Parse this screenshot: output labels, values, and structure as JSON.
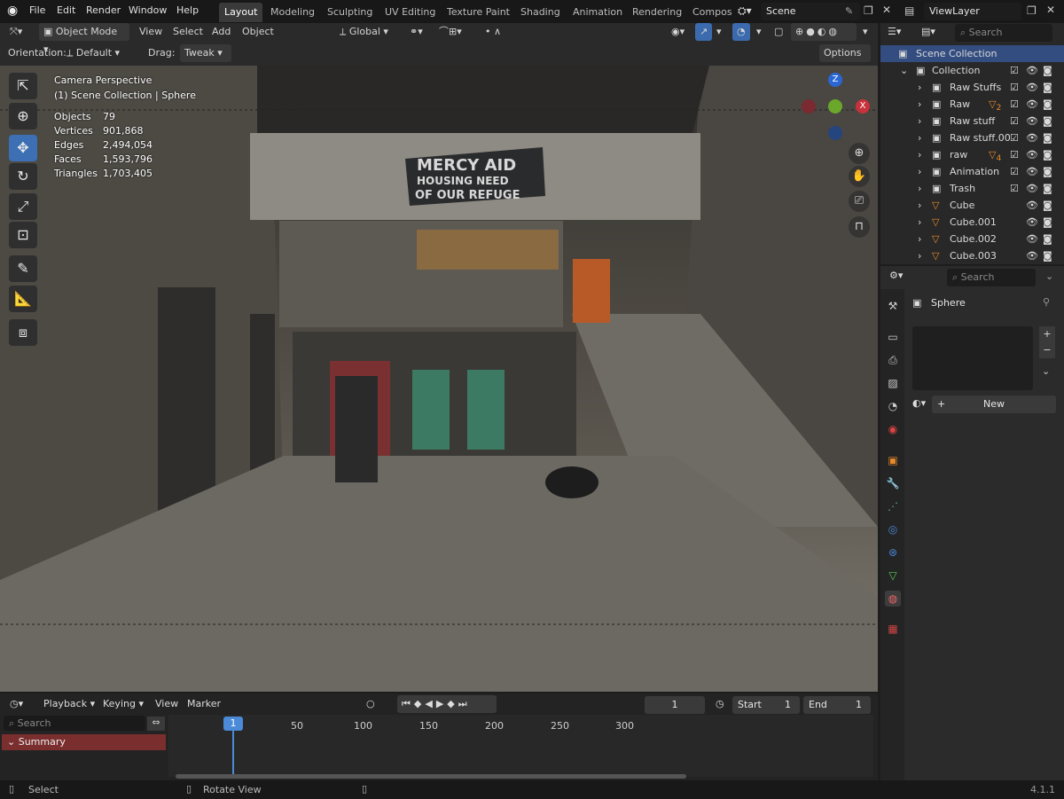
{
  "menu": {
    "file": "File",
    "edit": "Edit",
    "render": "Render",
    "window": "Window",
    "help": "Help"
  },
  "workspaces": [
    "Layout",
    "Modeling",
    "Sculpting",
    "UV Editing",
    "Texture Paint",
    "Shading",
    "Animation",
    "Rendering",
    "Compos"
  ],
  "scene": "Scene",
  "view_layer": "ViewLayer",
  "vp_header": {
    "mode": "Object Mode",
    "view": "View",
    "select": "Select",
    "add": "Add",
    "object": "Object",
    "transform": "Global",
    "orientation_label": "Orientation:",
    "orientation": "Default",
    "drag_label": "Drag:",
    "drag": "Tweak",
    "options": "Options"
  },
  "overlay": {
    "camera": "Camera Perspective",
    "collection": "(1) Scene Collection | Sphere",
    "stats": [
      {
        "k": "Objects",
        "v": "79"
      },
      {
        "k": "Vertices",
        "v": "901,868"
      },
      {
        "k": "Edges",
        "v": "2,494,054"
      },
      {
        "k": "Faces",
        "v": "1,593,796"
      },
      {
        "k": "Triangles",
        "v": "1,703,405"
      }
    ]
  },
  "scene_art": {
    "sign1": "MERCY AID",
    "sign2": "HOUSING   NEED",
    "sign3": "OF OUR REFUGE"
  },
  "outliner": {
    "search": "Search",
    "root": "Scene Collection",
    "collection": "Collection",
    "items": [
      {
        "name": "Raw Stuffs",
        "badge": ""
      },
      {
        "name": "Raw",
        "badge": "2"
      },
      {
        "name": "Raw stuff",
        "badge": ""
      },
      {
        "name": "Raw stuff.00",
        "badge": ""
      },
      {
        "name": "raw",
        "badge": "4"
      },
      {
        "name": "Animation",
        "badge": ""
      },
      {
        "name": "Trash",
        "badge": ""
      },
      {
        "name": "Cube",
        "badge": ""
      },
      {
        "name": "Cube.001",
        "badge": ""
      },
      {
        "name": "Cube.002",
        "badge": ""
      },
      {
        "name": "Cube.003",
        "badge": ""
      }
    ]
  },
  "properties": {
    "search": "Search",
    "object": "Sphere",
    "new_button": "New"
  },
  "timeline": {
    "playback": "Playback",
    "keying": "Keying",
    "view": "View",
    "marker": "Marker",
    "current_frame": "1",
    "start_label": "Start",
    "start": "1",
    "end_label": "End",
    "end": "1",
    "search": "Search",
    "summary": "Summary",
    "ticks": [
      "1",
      "50",
      "100",
      "150",
      "200",
      "250",
      "300"
    ]
  },
  "status": {
    "select": "Select",
    "rotate": "Rotate View",
    "version": "4.1.1"
  },
  "colors": {
    "accent": "#3d6fb4",
    "selected_row": "#334d80",
    "summary": "#7a2e2e",
    "playhead": "#4a8ad8"
  }
}
